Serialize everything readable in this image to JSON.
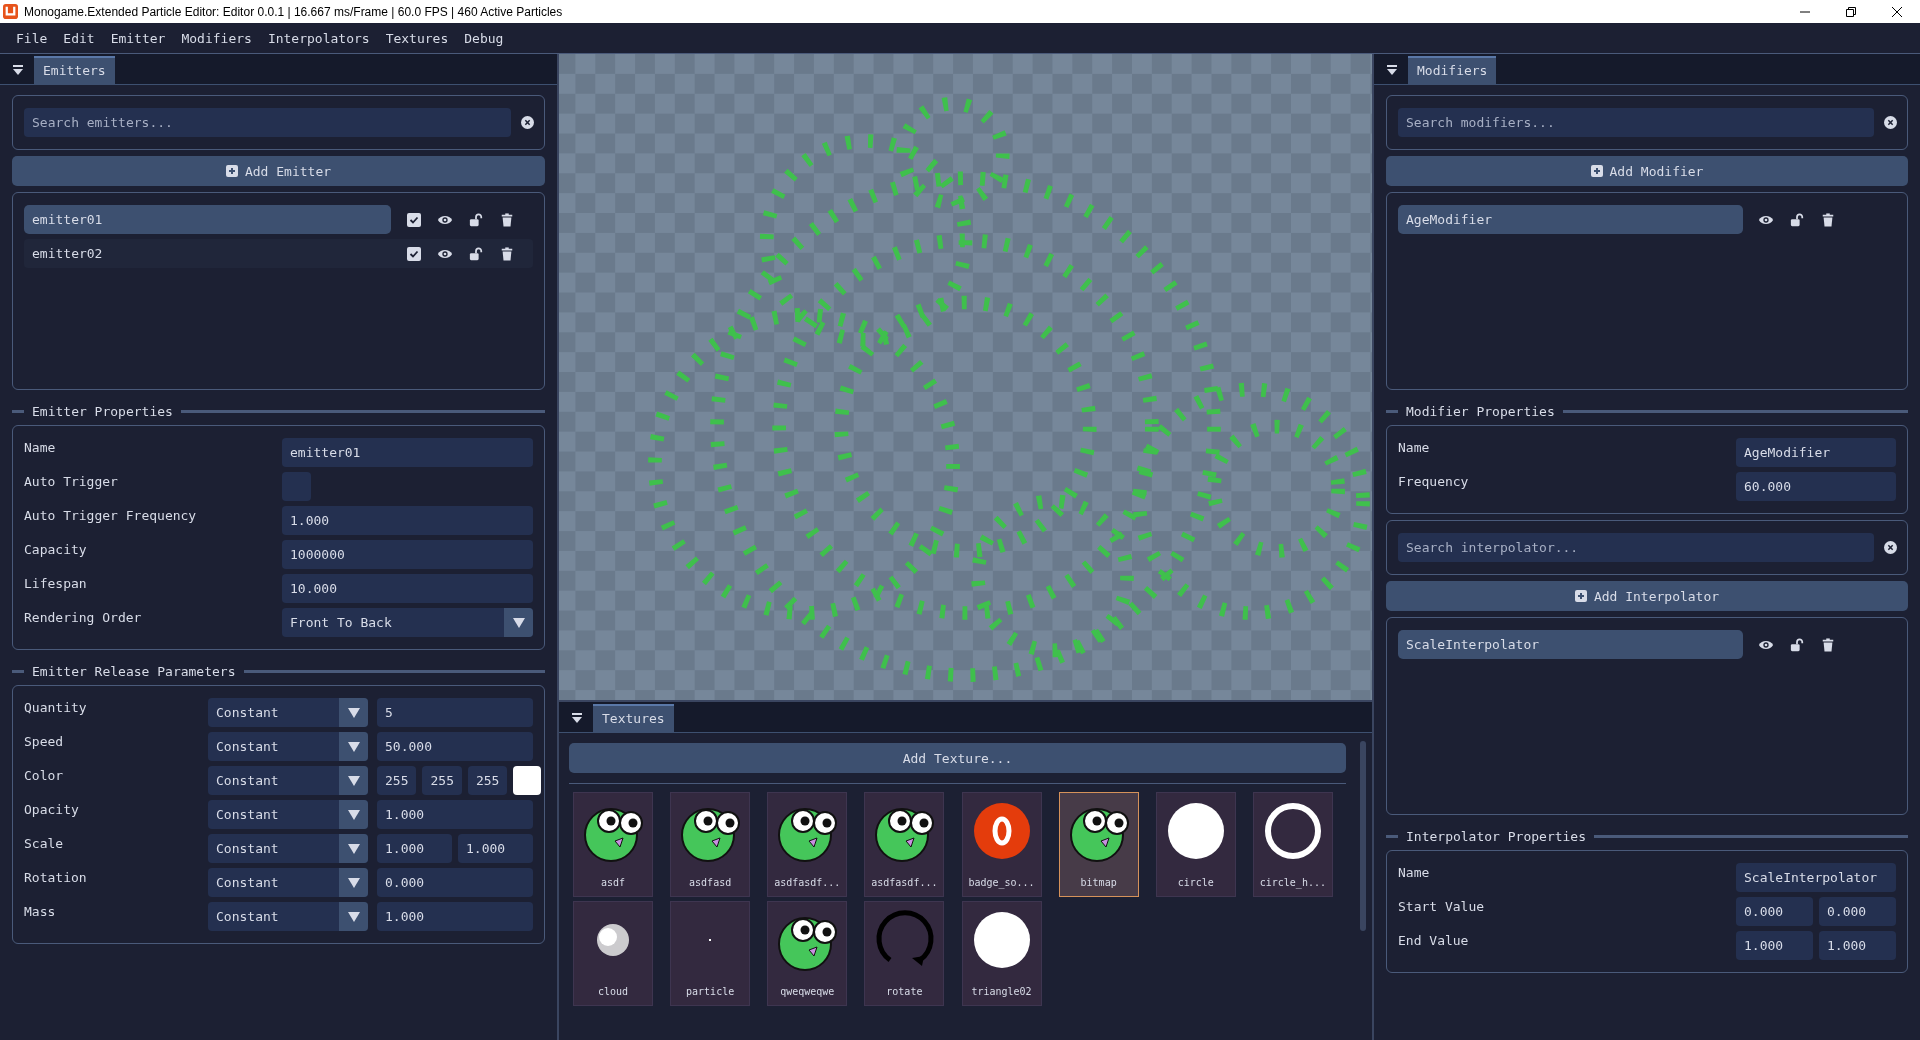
{
  "window": {
    "title": "Monogame.Extended Particle Editor: Editor 0.0.1 | 16.667 ms/Frame | 60.0 FPS | 460 Active Particles"
  },
  "menu": [
    "File",
    "Edit",
    "Emitter",
    "Modifiers",
    "Interpolators",
    "Textures",
    "Debug"
  ],
  "emitters_panel": {
    "tab": "Emitters",
    "search": {
      "placeholder": "Search emitters..."
    },
    "add_button": "Add Emitter",
    "items": [
      {
        "name": "emitter01",
        "selected": true,
        "checked": true
      },
      {
        "name": "emitter02",
        "selected": false,
        "checked": true
      }
    ]
  },
  "emitter_properties": {
    "title": "Emitter Properties",
    "rows": [
      {
        "kind": "text",
        "label": "Name",
        "value": "emitter01"
      },
      {
        "kind": "checkbox",
        "label": "Auto Trigger",
        "checked": false
      },
      {
        "kind": "text",
        "label": "Auto Trigger Frequency",
        "value": "1.000"
      },
      {
        "kind": "text",
        "label": "Capacity",
        "value": "1000000"
      },
      {
        "kind": "text",
        "label": "Lifespan",
        "value": "10.000"
      },
      {
        "kind": "select",
        "label": "Rendering Order",
        "value": "Front To Back"
      }
    ]
  },
  "release_parameters": {
    "title": "Emitter Release Parameters",
    "rows": [
      {
        "label": "Quantity",
        "mode": "Constant",
        "values": [
          "5"
        ]
      },
      {
        "label": "Speed",
        "mode": "Constant",
        "values": [
          "50.000"
        ]
      },
      {
        "label": "Color",
        "mode": "Constant",
        "values": [
          "255",
          "255",
          "255"
        ],
        "color": "#ffffff"
      },
      {
        "label": "Opacity",
        "mode": "Constant",
        "values": [
          "1.000"
        ]
      },
      {
        "label": "Scale",
        "mode": "Constant",
        "values": [
          "1.000",
          "1.000"
        ]
      },
      {
        "label": "Rotation",
        "mode": "Constant",
        "values": [
          "0.000"
        ]
      },
      {
        "label": "Mass",
        "mode": "Constant",
        "values": [
          "1.000"
        ]
      }
    ]
  },
  "textures_panel": {
    "tab": "Textures",
    "add_button": "Add Texture...",
    "items": [
      {
        "label": "asdf",
        "kind": "face",
        "selected": false
      },
      {
        "label": "asdfasd",
        "kind": "face",
        "selected": false
      },
      {
        "label": "asdfasdf...",
        "kind": "face",
        "selected": false
      },
      {
        "label": "asdfasdf...",
        "kind": "face",
        "selected": false
      },
      {
        "label": "badge_so...",
        "kind": "badge",
        "selected": false
      },
      {
        "label": "bitmap",
        "kind": "face",
        "selected": true
      },
      {
        "label": "circle",
        "kind": "circle",
        "selected": false
      },
      {
        "label": "circle_h...",
        "kind": "ring",
        "selected": false
      },
      {
        "label": "cloud",
        "kind": "cloud",
        "selected": false
      },
      {
        "label": "particle",
        "kind": "dot",
        "selected": false
      },
      {
        "label": "qweqweqwe",
        "kind": "face",
        "selected": false
      },
      {
        "label": "rotate",
        "kind": "rotate",
        "selected": false
      },
      {
        "label": "triangle02",
        "kind": "circle",
        "selected": false
      }
    ]
  },
  "modifiers_panel": {
    "tab": "Modifiers",
    "search": {
      "placeholder": "Search modifiers..."
    },
    "add_button": "Add Modifier",
    "items": [
      {
        "name": "AgeModifier",
        "selected": true
      }
    ]
  },
  "modifier_properties": {
    "title": "Modifier Properties",
    "rows": [
      {
        "label": "Name",
        "values": [
          "AgeModifier"
        ]
      },
      {
        "label": "Frequency",
        "values": [
          "60.000"
        ]
      }
    ]
  },
  "interpolators": {
    "search": {
      "placeholder": "Search interpolator..."
    },
    "add_button": "Add Interpolator",
    "items": [
      {
        "name": "ScaleInterpolator",
        "selected": true
      }
    ]
  },
  "interpolator_properties": {
    "title": "Interpolator Properties",
    "rows": [
      {
        "label": "Name",
        "values": [
          "ScaleInterpolator"
        ]
      },
      {
        "label": "Start Value",
        "values": [
          "0.000",
          "0.000"
        ]
      },
      {
        "label": "End Value",
        "values": [
          "1.000",
          "1.000"
        ]
      }
    ]
  }
}
